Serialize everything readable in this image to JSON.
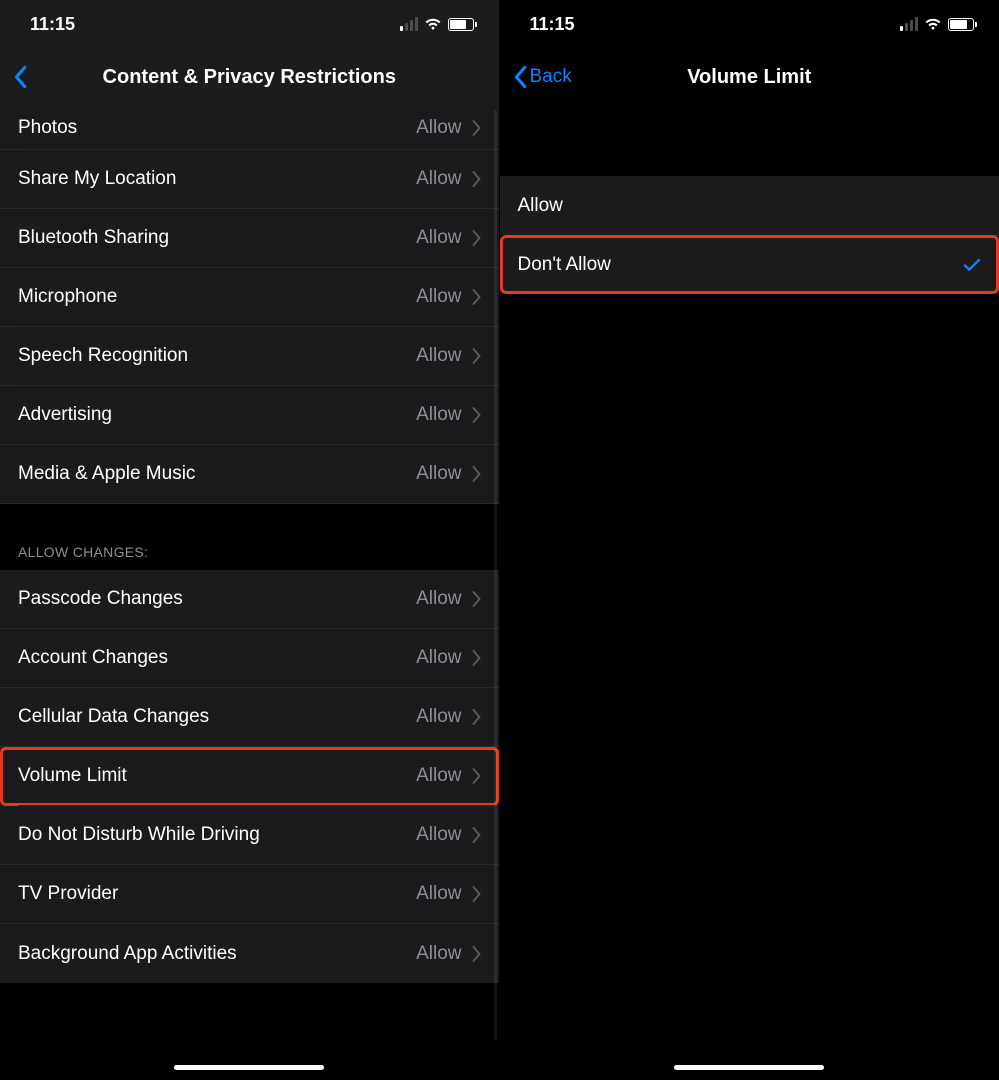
{
  "status": {
    "time": "11:15"
  },
  "left": {
    "title": "Content & Privacy Restrictions",
    "section1": [
      {
        "label": "Photos",
        "value": "Allow"
      },
      {
        "label": "Share My Location",
        "value": "Allow"
      },
      {
        "label": "Bluetooth Sharing",
        "value": "Allow"
      },
      {
        "label": "Microphone",
        "value": "Allow"
      },
      {
        "label": "Speech Recognition",
        "value": "Allow"
      },
      {
        "label": "Advertising",
        "value": "Allow"
      },
      {
        "label": "Media & Apple Music",
        "value": "Allow"
      }
    ],
    "section2_header": "Allow Changes:",
    "section2": [
      {
        "label": "Passcode Changes",
        "value": "Allow"
      },
      {
        "label": "Account Changes",
        "value": "Allow"
      },
      {
        "label": "Cellular Data Changes",
        "value": "Allow"
      },
      {
        "label": "Volume Limit",
        "value": "Allow",
        "highlight": true
      },
      {
        "label": "Do Not Disturb While Driving",
        "value": "Allow"
      },
      {
        "label": "TV Provider",
        "value": "Allow"
      },
      {
        "label": "Background App Activities",
        "value": "Allow"
      }
    ]
  },
  "right": {
    "back_label": "Back",
    "title": "Volume Limit",
    "options": [
      {
        "label": "Allow",
        "selected": false
      },
      {
        "label": "Don't Allow",
        "selected": true,
        "highlight": true
      }
    ]
  }
}
